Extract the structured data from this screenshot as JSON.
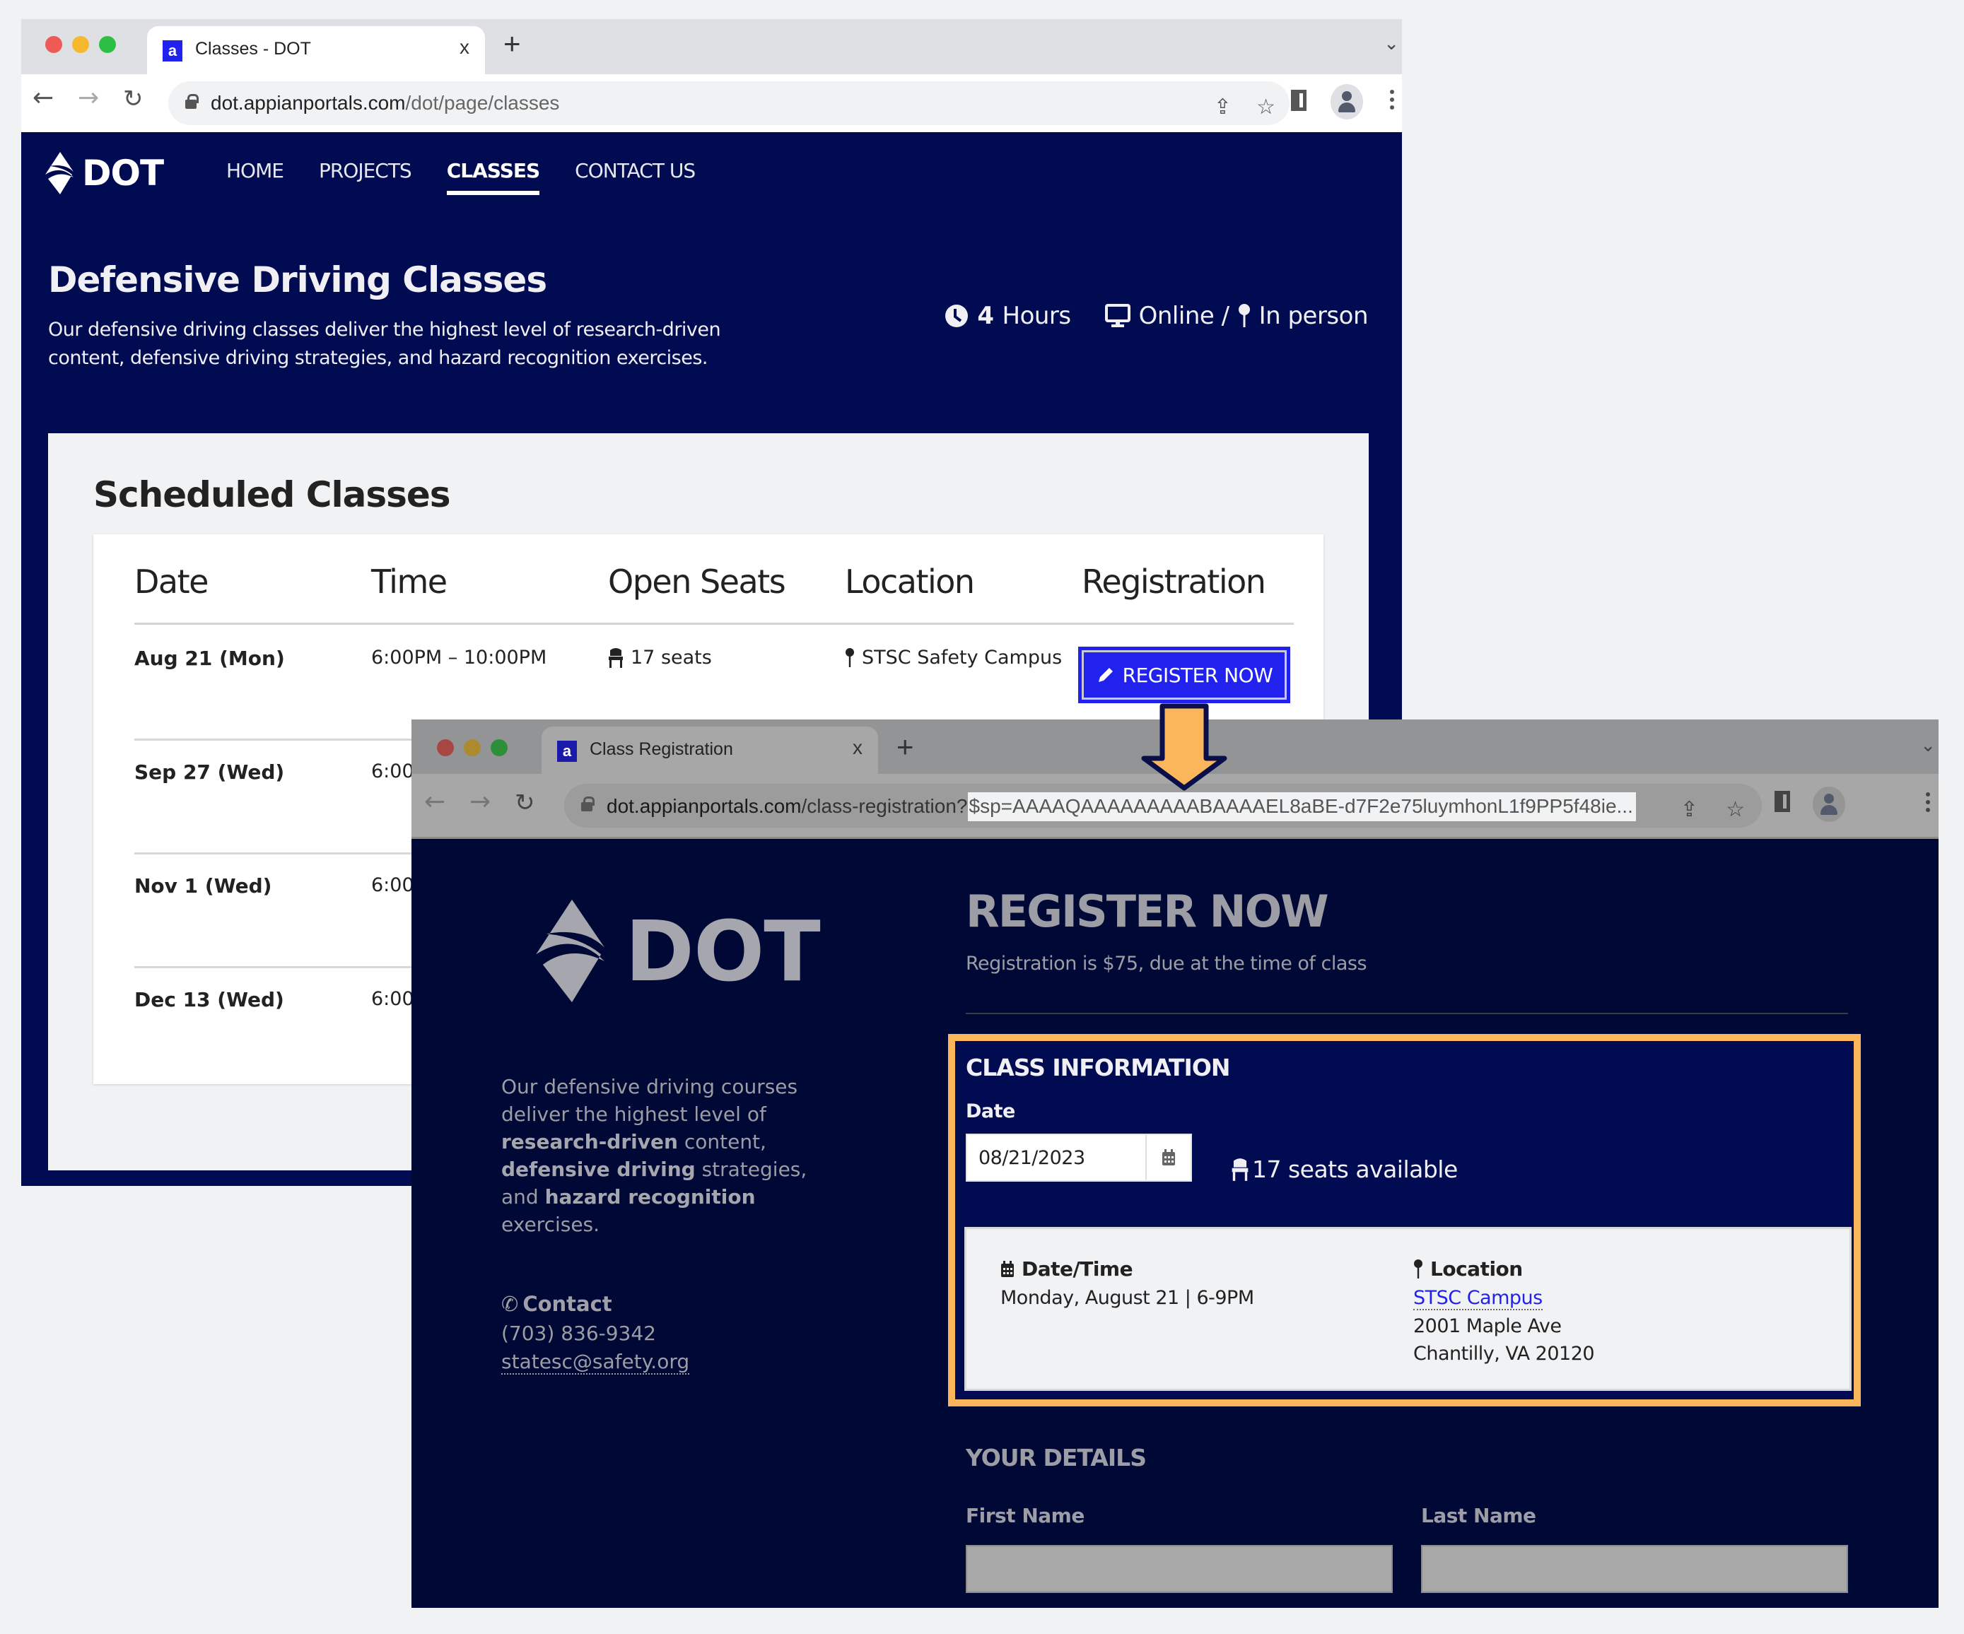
{
  "window1": {
    "tab_title": "Classes - DOT",
    "favicon_letter": "a",
    "tab_close": "x",
    "new_tab": "+",
    "url_host": "dot.appianportals.com",
    "url_path": "/dot/page/classes",
    "site": {
      "logo_text": "DOT",
      "nav": [
        {
          "label": "HOME",
          "active": false
        },
        {
          "label": "PROJECTS",
          "active": false
        },
        {
          "label": "CLASSES",
          "active": true
        },
        {
          "label": "CONTACT US",
          "active": false
        }
      ],
      "hero_title": "Defensive Driving Classes",
      "hero_desc": "Our defensive driving classes deliver the highest level of research-driven content, defensive driving strategies, and hazard recognition exercises.",
      "duration_value": "4",
      "duration_unit": "Hours",
      "format_online": "Online /",
      "format_inperson": "In person",
      "schedule_title": "Scheduled Classes",
      "table": {
        "columns": [
          "Date",
          "Time",
          "Open Seats",
          "Location",
          "Registration"
        ],
        "rows": [
          {
            "date": "Aug 21 (Mon)",
            "time": "6:00PM – 10:00PM",
            "seats": "17 seats",
            "location": "STSC Safety Campus",
            "action": "REGISTER NOW"
          },
          {
            "date": "Sep 27 (Wed)",
            "time": "6:00",
            "seats": "",
            "location": "",
            "action": ""
          },
          {
            "date": "Nov 1 (Wed)",
            "time": "6:00",
            "seats": "",
            "location": "",
            "action": ""
          },
          {
            "date": "Dec 13 (Wed)",
            "time": "6:00",
            "seats": "",
            "location": "",
            "action": ""
          }
        ]
      }
    }
  },
  "window2": {
    "tab_title": "Class Registration",
    "favicon_letter": "a",
    "tab_close": "x",
    "new_tab": "+",
    "url_host": "dot.appianportals.com",
    "url_path": "/class-registration?",
    "url_query": "$sp=AAAAQAAAAAAAAABAAAAEL8aBE-d7F2e75luymhonL1f9PP5f48ie...",
    "site": {
      "logo_text": "DOT",
      "desc_parts": [
        {
          "text": "Our defensive driving courses deliver the highest level of ",
          "bold": false
        },
        {
          "text": "research-driven",
          "bold": true
        },
        {
          "text": " content, ",
          "bold": false
        },
        {
          "text": "defensive driving",
          "bold": true
        },
        {
          "text": " strategies, and ",
          "bold": false
        },
        {
          "text": "hazard recognition",
          "bold": true
        },
        {
          "text": " exercises.",
          "bold": false
        }
      ],
      "contact_title": "Contact",
      "contact_phone": "(703) 836-9342",
      "contact_email": "statesc@safety.org",
      "title": "REGISTER NOW",
      "subtitle": "Registration is $75, due at the time of class",
      "class_info": {
        "title": "CLASS INFORMATION",
        "date_label": "Date",
        "date_value": "08/21/2023",
        "seats_available": "17 seats available",
        "datetime_label": "Date/Time",
        "datetime_value": "Monday, August 21 | 6-9PM",
        "location_label": "Location",
        "location_link": "STSC Campus",
        "address_line1": "2001 Maple Ave",
        "address_line2": "Chantilly, VA 20120"
      },
      "your_details_title": "YOUR DETAILS",
      "first_name_label": "First Name",
      "first_name_value": "",
      "last_name_label": "Last Name",
      "last_name_value": ""
    }
  },
  "colors": {
    "brand_navy": "#000b52",
    "register_button": "#2222ee",
    "highlight_orange": "#fbb55a",
    "link_blue": "#2222ee"
  }
}
